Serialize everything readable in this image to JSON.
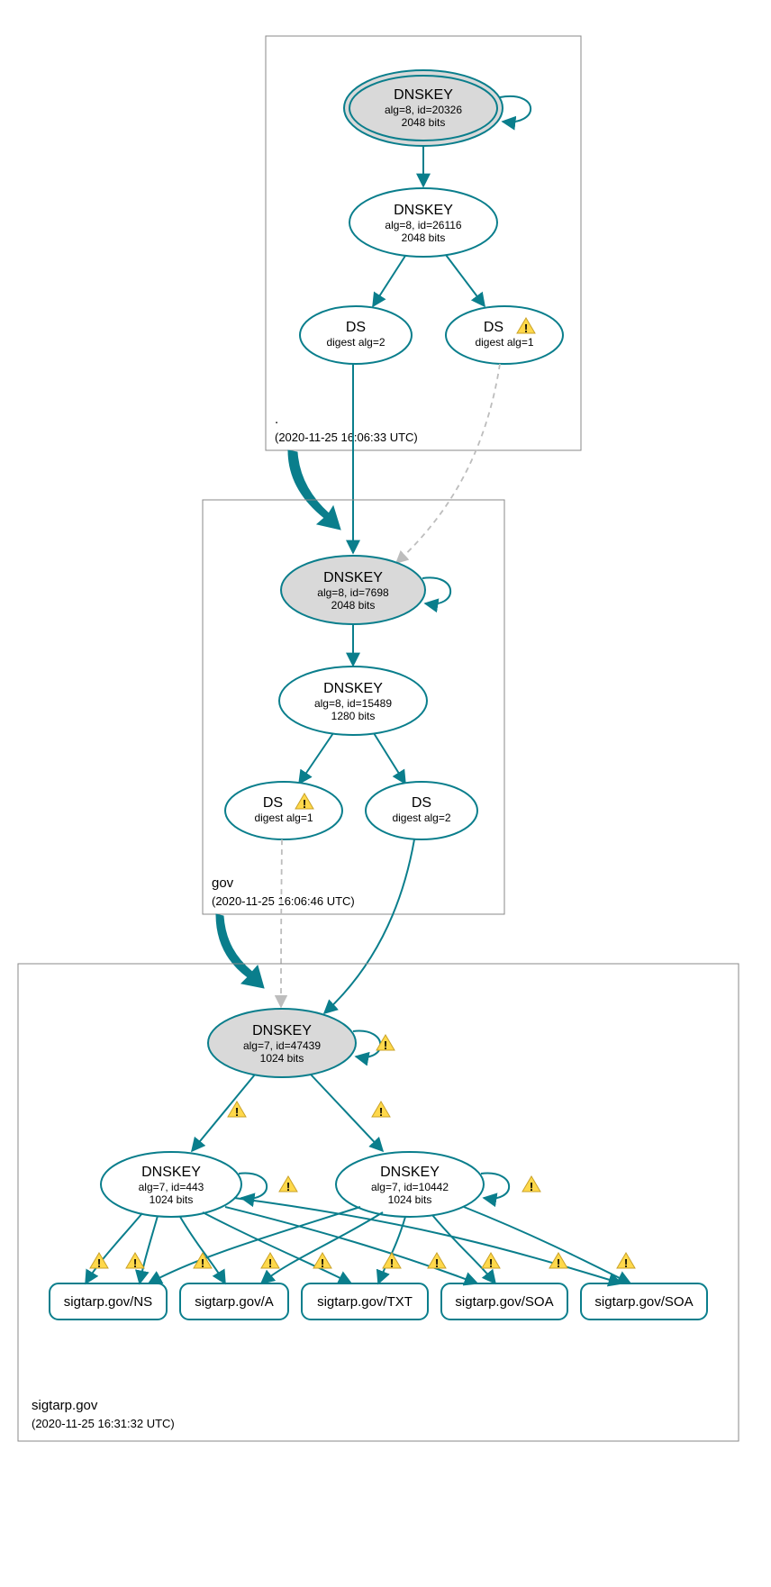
{
  "colors": {
    "teal": "#0a7e8c",
    "grey": "#d9d9d9",
    "warn": "#ffd84a"
  },
  "zones": {
    "root": {
      "label": ".",
      "timestamp": "(2020-11-25 16:06:33 UTC)"
    },
    "gov": {
      "label": "gov",
      "timestamp": "(2020-11-25 16:06:46 UTC)"
    },
    "sigtarp": {
      "label": "sigtarp.gov",
      "timestamp": "(2020-11-25 16:31:32 UTC)"
    }
  },
  "nodes": {
    "root_ksk": {
      "title": "DNSKEY",
      "line2": "alg=8, id=20326",
      "line3": "2048 bits"
    },
    "root_zsk": {
      "title": "DNSKEY",
      "line2": "alg=8, id=26116",
      "line3": "2048 bits"
    },
    "root_ds2": {
      "title": "DS",
      "line2": "digest alg=2"
    },
    "root_ds1": {
      "title": "DS",
      "line2": "digest alg=1"
    },
    "gov_ksk": {
      "title": "DNSKEY",
      "line2": "alg=8, id=7698",
      "line3": "2048 bits"
    },
    "gov_zsk": {
      "title": "DNSKEY",
      "line2": "alg=8, id=15489",
      "line3": "1280 bits"
    },
    "gov_ds1": {
      "title": "DS",
      "line2": "digest alg=1"
    },
    "gov_ds2": {
      "title": "DS",
      "line2": "digest alg=2"
    },
    "sig_ksk": {
      "title": "DNSKEY",
      "line2": "alg=7, id=47439",
      "line3": "1024 bits"
    },
    "sig_zsk1": {
      "title": "DNSKEY",
      "line2": "alg=7, id=443",
      "line3": "1024 bits"
    },
    "sig_zsk2": {
      "title": "DNSKEY",
      "line2": "alg=7, id=10442",
      "line3": "1024 bits"
    }
  },
  "rrsets": {
    "ns": "sigtarp.gov/NS",
    "a": "sigtarp.gov/A",
    "txt": "sigtarp.gov/TXT",
    "soa1": "sigtarp.gov/SOA",
    "soa2": "sigtarp.gov/SOA"
  }
}
